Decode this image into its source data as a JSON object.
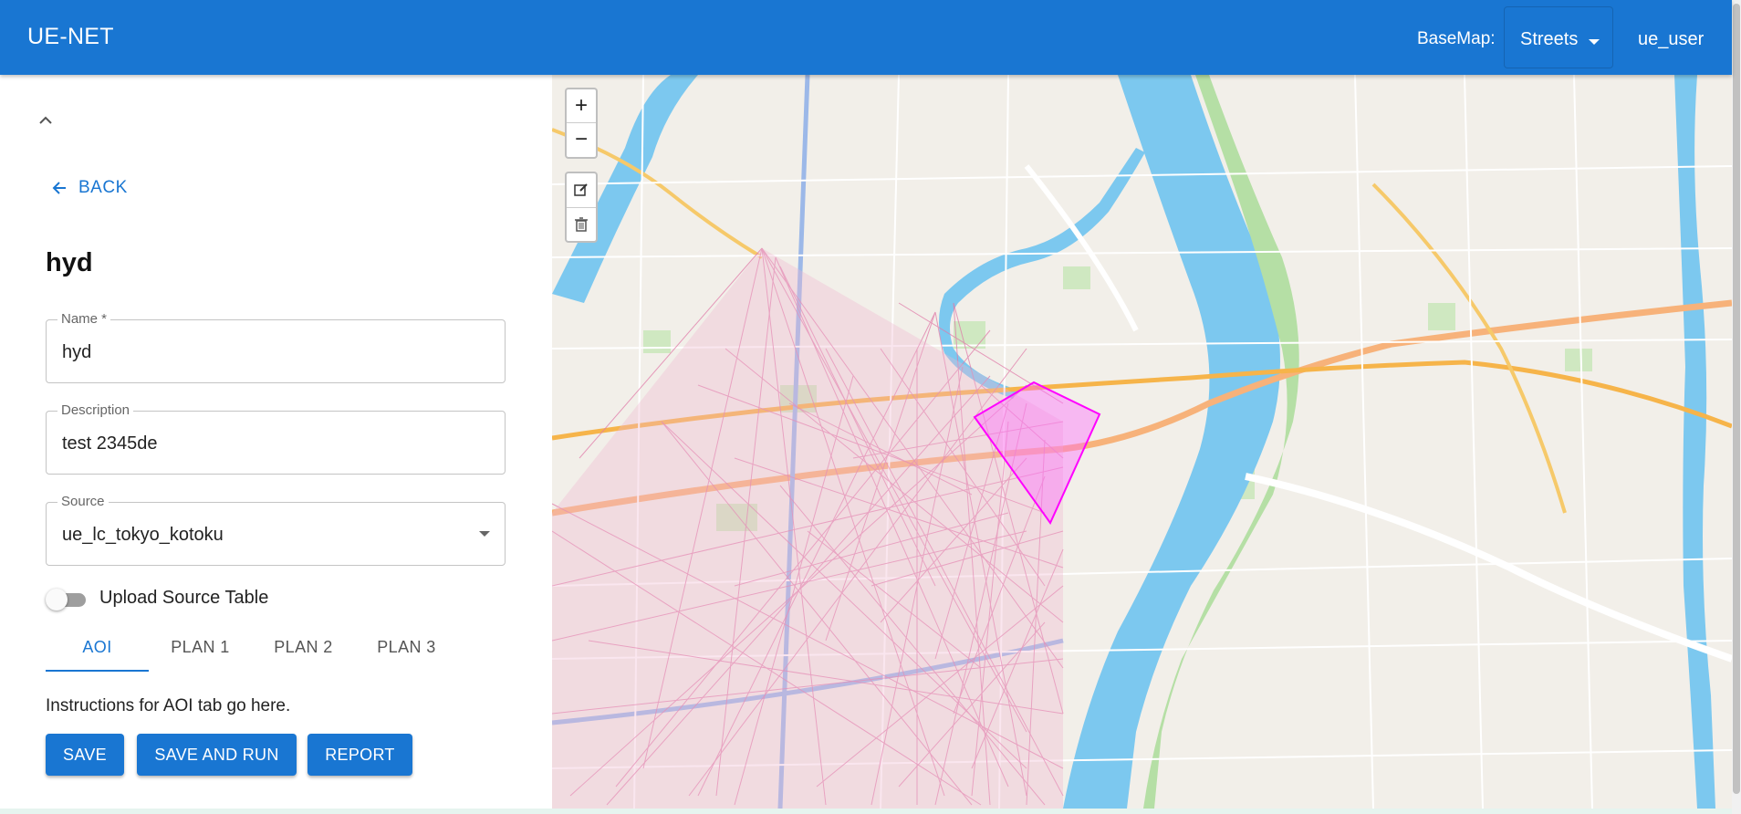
{
  "appbar": {
    "title": "UE-NET",
    "basemap_label": "BaseMap:",
    "basemap_value": "Streets",
    "user": "ue_user",
    "color": "#1976d2"
  },
  "panel": {
    "collapse_icon": "chevron-up-icon",
    "back_label": "BACK",
    "heading": "hyd",
    "fields": {
      "name": {
        "label": "Name *",
        "value": "hyd"
      },
      "description": {
        "label": "Description",
        "value": "test 2345de"
      },
      "source": {
        "label": "Source",
        "value": "ue_lc_tokyo_kotoku"
      }
    },
    "upload_toggle": {
      "label": "Upload Source Table",
      "checked": false
    },
    "tabs": [
      {
        "label": "AOI",
        "active": true
      },
      {
        "label": "PLAN 1",
        "active": false
      },
      {
        "label": "PLAN 2",
        "active": false
      },
      {
        "label": "PLAN 3",
        "active": false
      }
    ],
    "instructions": "Instructions for AOI tab go here.",
    "buttons": {
      "save": "SAVE",
      "save_and_run": "SAVE AND RUN",
      "report": "REPORT"
    }
  },
  "map": {
    "zoom_in": "+",
    "zoom_out": "−",
    "draw_tools": [
      "edit-icon",
      "trash-icon"
    ],
    "aoi_color": "#ff00ff",
    "lines_color": "#e07aa8",
    "river_color": "#7cc8ef"
  }
}
